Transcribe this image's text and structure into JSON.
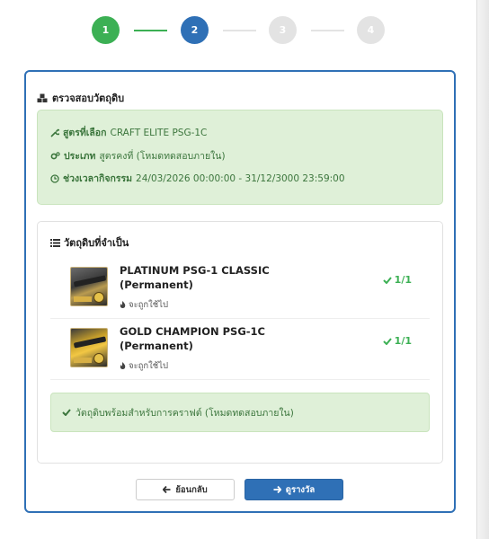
{
  "stepper": {
    "steps": [
      {
        "label": "1",
        "state": "done"
      },
      {
        "label": "2",
        "state": "active"
      },
      {
        "label": "3",
        "state": "todo"
      },
      {
        "label": "4",
        "state": "todo"
      }
    ]
  },
  "panel": {
    "title": "ตรวจสอบวัตถุดิบ",
    "info": {
      "recipe_label": "สูตรที่เลือก",
      "recipe_value": "CRAFT ELITE PSG-1C",
      "type_label": "ประเภท",
      "type_value": "สูตรคงที่ (โหมดทดสอบภายใน)",
      "period_label": "ช่วงเวลากิจกรรม",
      "period_value": "24/03/2026 00:00:00 - 31/12/3000 23:59:00"
    },
    "requirements": {
      "title": "วัตถุดิบที่จำเป็น",
      "items": [
        {
          "name": "PLATINUM PSG-1 CLASSIC",
          "duration": "(Permanent)",
          "note": "จะถูกใช้ไป",
          "count": "1/1"
        },
        {
          "name": "GOLD CHAMPION PSG-1C",
          "duration": "(Permanent)",
          "note": "จะถูกใช้ไป",
          "count": "1/1"
        }
      ],
      "ready_message": "วัตถุดิบพร้อมสำหรับการคราฟต์ (โหมดทดสอบภายใน)"
    }
  },
  "buttons": {
    "back_label": "ย้อนกลับ",
    "next_label": "ดูรางวัล"
  },
  "colors": {
    "primary": "#2f70b6",
    "success": "#3cb054",
    "success_bg": "#dff0d8",
    "success_text": "#3c763d"
  }
}
